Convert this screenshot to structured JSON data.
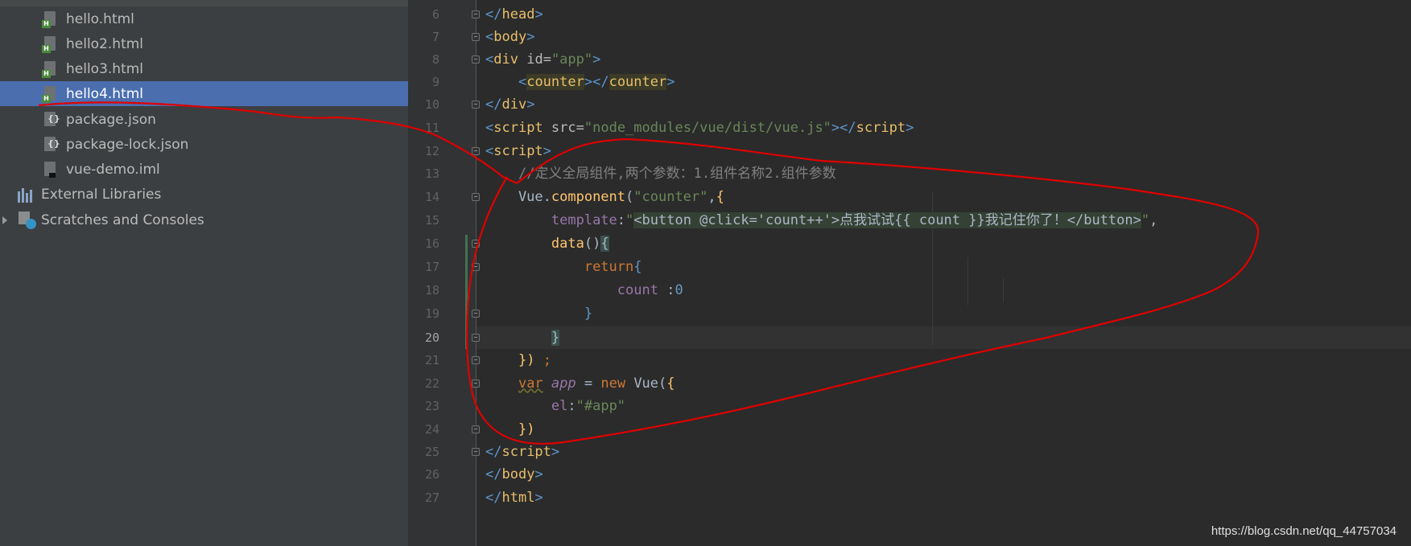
{
  "sidebar": {
    "files": [
      {
        "name": "hello.html",
        "type": "html"
      },
      {
        "name": "hello2.html",
        "type": "html"
      },
      {
        "name": "hello3.html",
        "type": "html"
      },
      {
        "name": "hello4.html",
        "type": "html",
        "selected": true
      },
      {
        "name": "package.json",
        "type": "json"
      },
      {
        "name": "package-lock.json",
        "type": "json"
      },
      {
        "name": "vue-demo.iml",
        "type": "iml"
      }
    ],
    "external_libraries": "External Libraries",
    "scratches": "Scratches and Consoles"
  },
  "editor": {
    "line_numbers": [
      "6",
      "7",
      "8",
      "9",
      "10",
      "11",
      "12",
      "13",
      "14",
      "15",
      "16",
      "17",
      "18",
      "19",
      "20",
      "21",
      "22",
      "23",
      "24",
      "25",
      "26",
      "27"
    ],
    "active_line": "20",
    "comment_line": "//定义全局组件,两个参数：1.组件名称2.组件参数",
    "template_text": "<button @click='count++'>点我试试{{ count }}我记住你了！</button>"
  },
  "watermark": "https://blog.csdn.net/qq_44757034",
  "colors": {
    "sidebar_bg": "#3c3f41",
    "selection": "#4b6eaf",
    "editor_bg": "#2b2b2b",
    "annotation": "#e00000"
  }
}
